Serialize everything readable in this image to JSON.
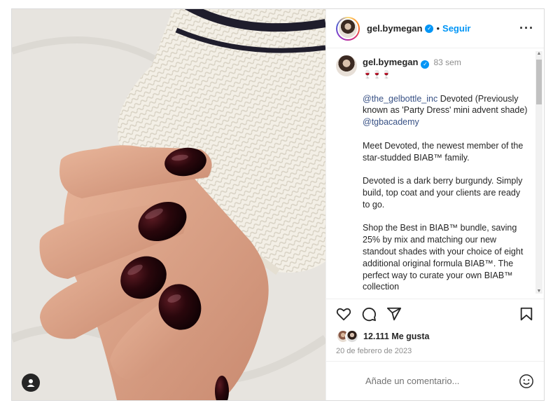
{
  "header": {
    "username": "gel.bymegan",
    "separator": "•",
    "follow_label": "Seguir",
    "more_icon": "more-horizontal-icon"
  },
  "caption": {
    "username": "gel.bymegan",
    "time": "83 sem",
    "emoji_line": "🍷🍷🍷",
    "mention_brand": "@the_gelbottle_inc",
    "line1_rest": " Devoted (Previously known as 'Party Dress' mini advent shade)",
    "mention_academy": "@tgbacademy",
    "para2": "Meet Devoted, the newest member of the star-studded BIAB™ family.",
    "para3": "Devoted is a dark berry burgundy. Simply build, top coat and your clients are ready to go.",
    "para4": "Shop the Best in BIAB™ bundle, saving 25% by mix and matching our new standout shades with your choice of eight additional original formula BIAB™. The perfect way to curate your own BIAB™ collection"
  },
  "actions": {
    "like_icon": "heart-icon",
    "comment_icon": "comment-icon",
    "share_icon": "share-icon",
    "save_icon": "bookmark-icon"
  },
  "likes": {
    "text": "12.111 Me gusta"
  },
  "date": "20 de febrero de 2023",
  "comment": {
    "placeholder": "Añade un comentario...",
    "emoji_icon": "smiley-icon"
  },
  "colors": {
    "link": "#0095f6",
    "mention": "#385185",
    "polish": "#1f0508",
    "sweater": "#f3efe6"
  }
}
